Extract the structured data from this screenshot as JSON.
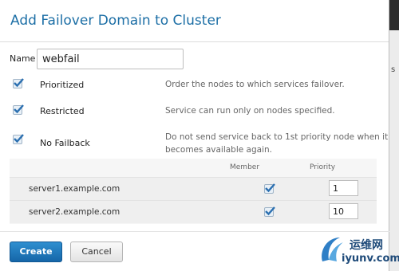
{
  "dialog": {
    "title": "Add Failover Domain to Cluster"
  },
  "name_field": {
    "label": "Name",
    "value": "webfail"
  },
  "options": [
    {
      "label": "Prioritized",
      "checked": true,
      "description": "Order the nodes to which services failover."
    },
    {
      "label": "Restricted",
      "checked": true,
      "description": "Service can run only on nodes specified."
    },
    {
      "label": "No Failback",
      "checked": true,
      "description": "Do not send service back to 1st priority node when it becomes available again."
    }
  ],
  "nodes_table": {
    "columns": {
      "member": "Member",
      "priority": "Priority"
    },
    "rows": [
      {
        "server": "server1.example.com",
        "member": true,
        "priority": "1"
      },
      {
        "server": "server2.example.com",
        "member": true,
        "priority": "10"
      }
    ]
  },
  "buttons": {
    "create": "Create",
    "cancel": "Cancel"
  },
  "background_fragment": "s",
  "watermark": {
    "line1": "运维网",
    "line2": "iyunv.com"
  },
  "colors": {
    "title": "#1d6fa6",
    "create_button": "#1f78bc",
    "checkbox_accent": "#2b6fb0"
  }
}
